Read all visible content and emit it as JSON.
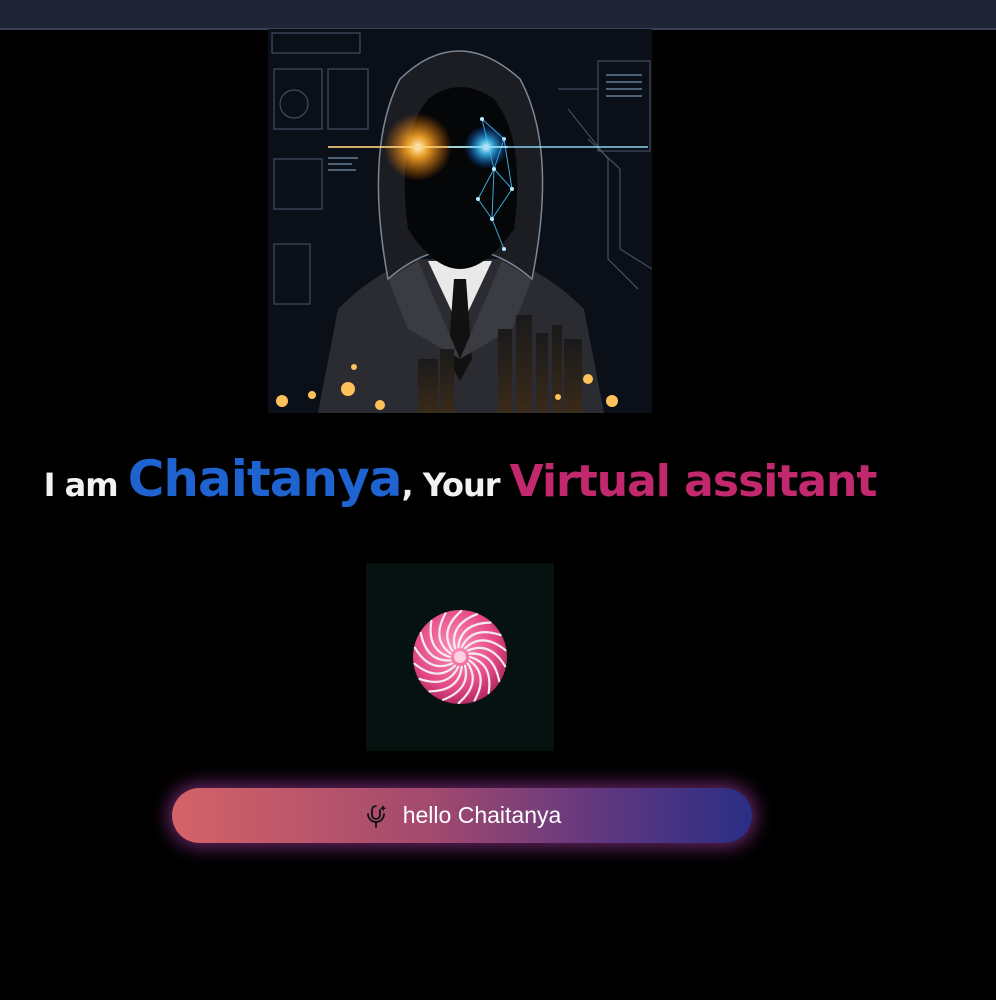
{
  "heading": {
    "prefix": "I am ",
    "name": "Chaitanya",
    "comma": ", Your ",
    "accent": "Virtual assitant"
  },
  "voice_button": {
    "label": "hello Chaitanya",
    "icon": "mic-sparkle-icon"
  },
  "hero_image": {
    "subject": "hooded-figure-portrait"
  },
  "loader": {
    "icon": "spinner-icon"
  },
  "colors": {
    "background": "#000000",
    "name": "#1e63d0",
    "accent": "#c2286e",
    "button_start": "#d46367",
    "button_end": "#2a2e85"
  }
}
